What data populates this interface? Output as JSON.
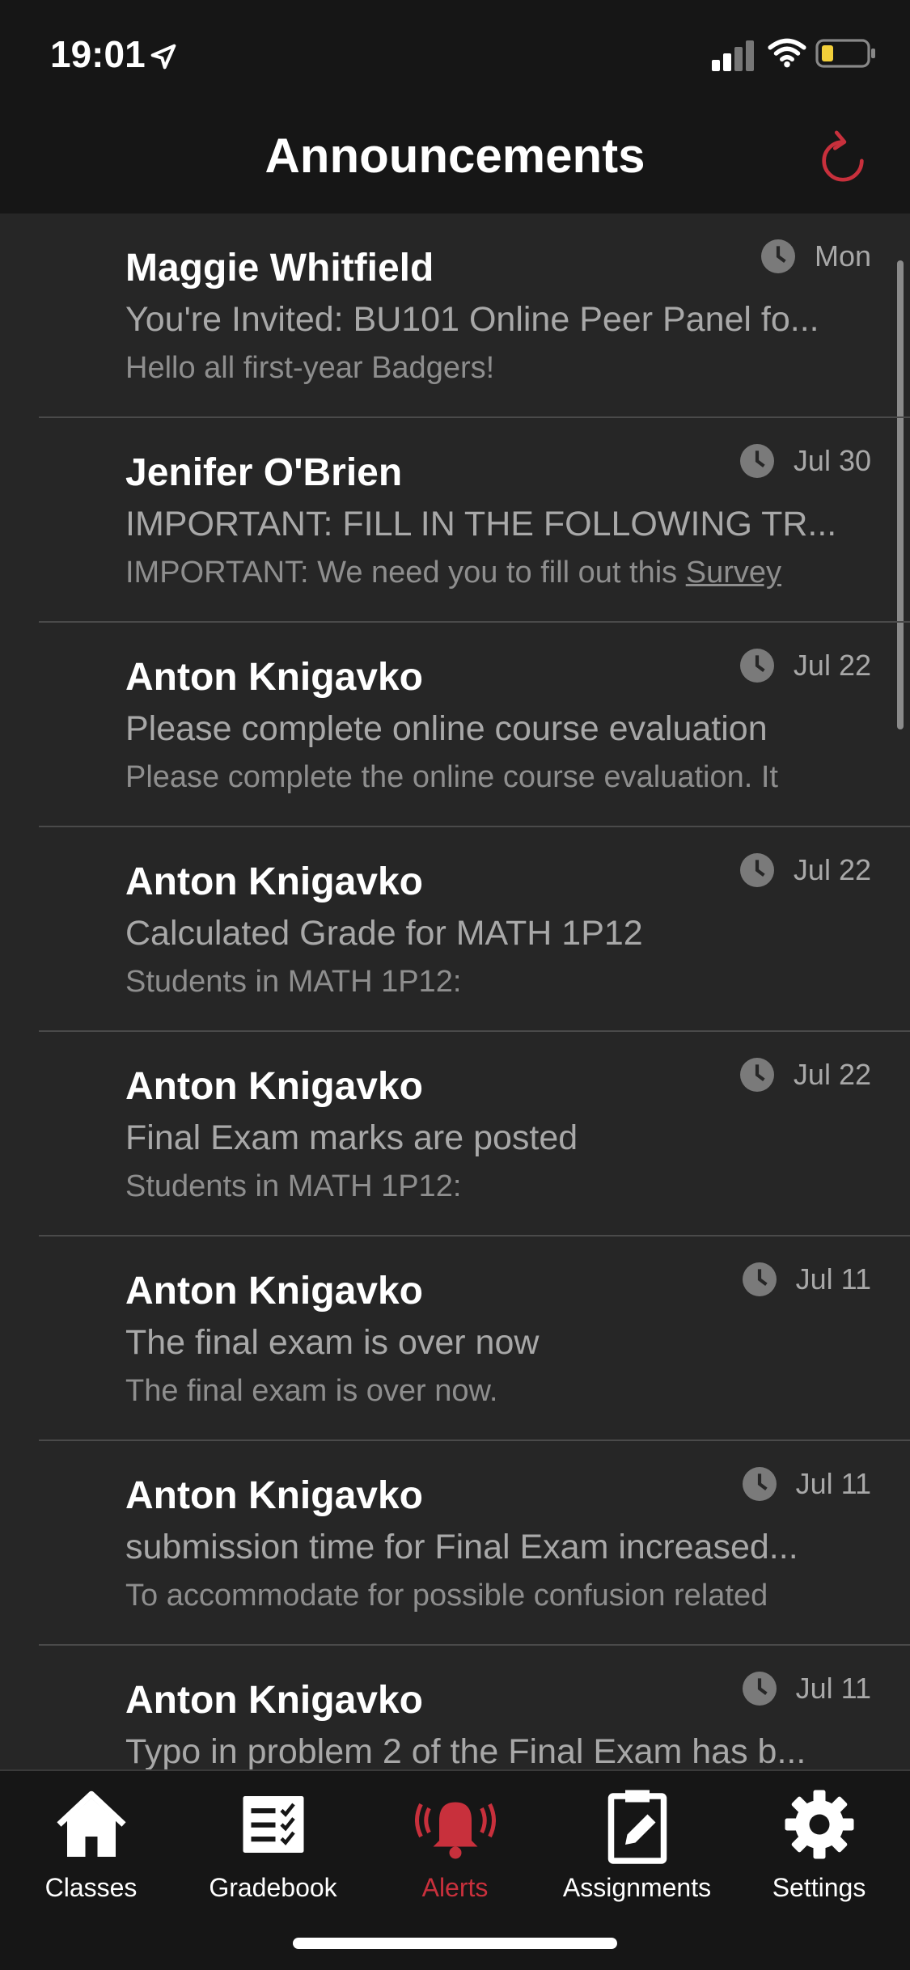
{
  "status_bar": {
    "time": "19:01"
  },
  "header": {
    "title": "Announcements"
  },
  "announcements": [
    {
      "author": "Maggie Whitfield",
      "date": "Mon",
      "subject": "You're Invited: BU101 Online Peer Panel fo...",
      "preview": "Hello all first-year Badgers!"
    },
    {
      "author": "Jenifer O'Brien",
      "date": "Jul 30",
      "subject": "IMPORTANT: FILL IN THE FOLLOWING TR...",
      "preview": "IMPORTANT: We need you to fill out this ",
      "preview_link": "Survey"
    },
    {
      "author": "Anton Knigavko",
      "date": "Jul 22",
      "subject": "Please complete online course evaluation",
      "preview": "Please complete the online course evaluation. It"
    },
    {
      "author": "Anton Knigavko",
      "date": "Jul 22",
      "subject": "Calculated Grade for MATH 1P12",
      "preview": "Students in MATH 1P12:"
    },
    {
      "author": "Anton Knigavko",
      "date": "Jul 22",
      "subject": "Final Exam marks are posted",
      "preview": "Students in MATH 1P12:"
    },
    {
      "author": "Anton Knigavko",
      "date": "Jul 11",
      "subject": "The final exam is over now",
      "preview": "The final exam is over now."
    },
    {
      "author": "Anton Knigavko",
      "date": "Jul 11",
      "subject": "submission time for Final Exam increased...",
      "preview": "To accommodate for possible confusion related"
    },
    {
      "author": "Anton Knigavko",
      "date": "Jul 11",
      "subject": "Typo in problem 2 of the Final Exam has b...",
      "preview": ""
    }
  ],
  "tabbar": {
    "classes": "Classes",
    "gradebook": "Gradebook",
    "alerts": "Alerts",
    "assignments": "Assignments",
    "settings": "Settings"
  },
  "colors": {
    "accent": "#c8303c",
    "background": "#262626",
    "bar": "#161616"
  }
}
